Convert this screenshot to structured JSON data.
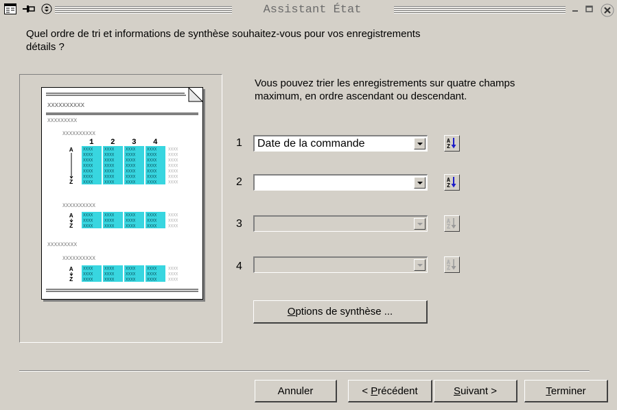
{
  "window": {
    "title": "Assistant État"
  },
  "header": {
    "question": "Quel ordre de tri et informations de synthèse souhaitez-vous pour vos enregistrements détails ?"
  },
  "instructions": "Vous pouvez trier les enregistrements sur quatre champs maximum, en ordre ascendant ou descendant.",
  "sort_rows": [
    {
      "number": "1",
      "value": "Date de la commande",
      "enabled": true
    },
    {
      "number": "2",
      "value": "",
      "enabled": true
    },
    {
      "number": "3",
      "value": "",
      "enabled": false
    },
    {
      "number": "4",
      "value": "",
      "enabled": false
    }
  ],
  "preview": {
    "column_numbers": [
      "1",
      "2",
      "3",
      "4"
    ],
    "placeholder": "XXXXXXXXXX",
    "short_placeholder": "XXXXXXXXX",
    "cell_text": "XXXX",
    "sort_glyph_top": "A",
    "sort_glyph_bottom": "Z"
  },
  "buttons": {
    "summary_options": {
      "label": "Options de synthèse ...",
      "mnemonic": "O",
      "rest": "ptions de synthèse ..."
    },
    "cancel": {
      "label": "Annuler"
    },
    "previous": {
      "prefix": "< ",
      "mnemonic": "P",
      "rest": "récédent"
    },
    "next": {
      "mnemonic": "S",
      "rest": "uivant >"
    },
    "finish": {
      "mnemonic": "T",
      "rest": "erminer"
    }
  },
  "colors": {
    "face": "#d4d0c8",
    "highlight_cells": "#38d6e0",
    "sort_icon_arrow": "#1c1cc8"
  }
}
